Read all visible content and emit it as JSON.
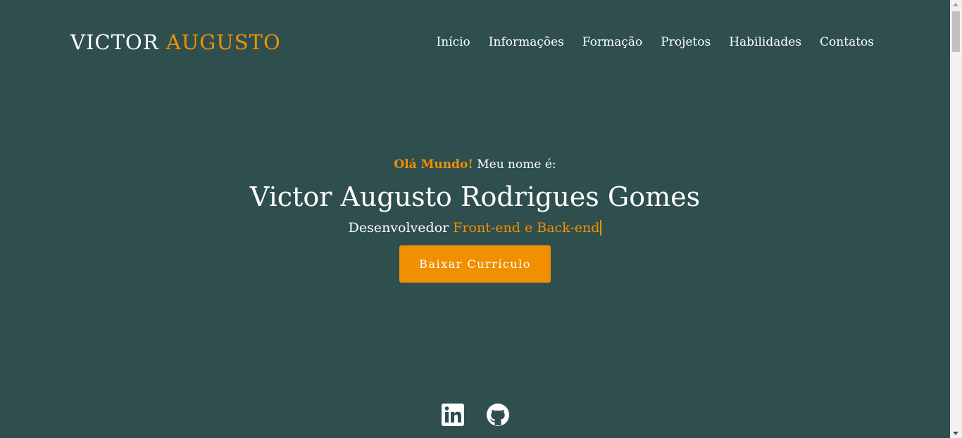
{
  "header": {
    "logo_first": "VICTOR",
    "logo_last": "AUGUSTO",
    "nav": [
      {
        "label": "Início"
      },
      {
        "label": "Informações"
      },
      {
        "label": "Formação"
      },
      {
        "label": "Projetos"
      },
      {
        "label": "Habilidades"
      },
      {
        "label": "Contatos"
      }
    ]
  },
  "hero": {
    "greeting_highlight": "Olá Mundo!",
    "greeting_rest": " Meu nome é:",
    "name": "Victor Augusto Rodrigues Gomes",
    "role_prefix": "Desenvolvedor ",
    "role_typed": "Front-end e Back-end",
    "cv_button": "Baixar Currículo"
  },
  "social": {
    "icons": [
      "linkedin-icon",
      "github-icon"
    ]
  },
  "colors": {
    "background": "#2f4f4f",
    "accent": "#f09000",
    "text": "#ffffff"
  }
}
